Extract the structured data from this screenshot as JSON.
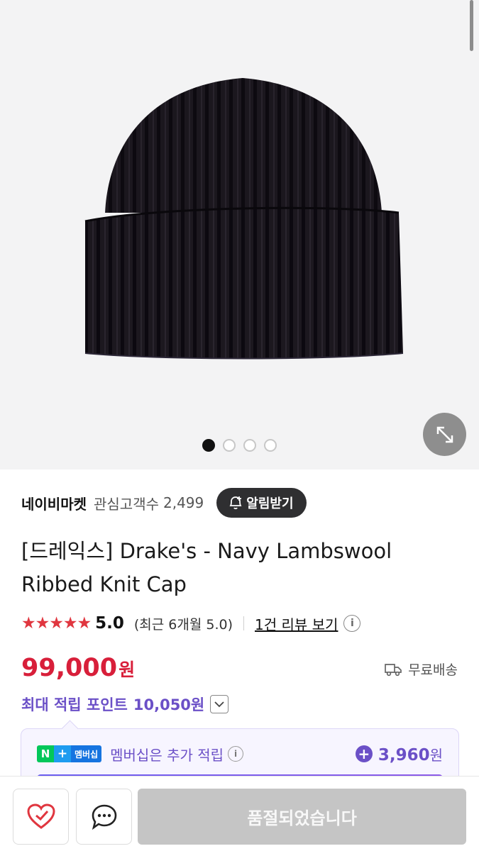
{
  "gallery": {
    "image_icon": "knit-beanie-image",
    "expand_icon": "expand-arrows-icon",
    "slide_count": 4,
    "active_slide": 1
  },
  "seller": {
    "name": "네이비마켓",
    "followers_label": "관심고객수",
    "followers_count": "2,499",
    "notify_label": "알림받기",
    "notify_icon": "bell-plus-icon"
  },
  "product": {
    "title_line1": "[드레익스] Drake's - Navy Lambswool",
    "title_line2": "Ribbed Knit Cap"
  },
  "rating": {
    "stars": "★★★★★",
    "score": "5.0",
    "recent": "(최근 6개월 5.0)",
    "review_link": "1건 리뷰 보기",
    "info_icon": "info-icon"
  },
  "price": {
    "amount": "99,000",
    "currency": "원",
    "shipping": "무료배송",
    "shipping_icon": "truck-icon"
  },
  "points": {
    "label": "최대 적립 포인트",
    "value": "10,050원",
    "toggle_icon": "chevron-down-icon"
  },
  "membership": {
    "badge_n": "N",
    "badge_plus": "+",
    "badge_text": "멤버십",
    "text": "멤버십은 추가 적립",
    "extra_value": "3,960",
    "extra_currency": "원",
    "accent": "#6b50c7"
  },
  "bottom_bar": {
    "like_icon": "heart-check-icon",
    "chat_icon": "chat-bubble-icon",
    "buy_label": "품절되었습니다"
  },
  "colors": {
    "price": "#d81f3a",
    "star": "#e0363f",
    "disabled_button": "#c5c5c5"
  }
}
